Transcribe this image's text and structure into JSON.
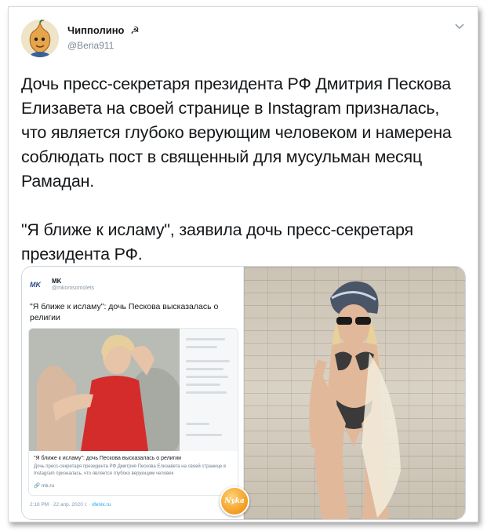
{
  "author": {
    "name": "Чипполино",
    "badge": "☭",
    "handle": "@Beria911",
    "avatar_icon": "cipollino-avatar"
  },
  "tweet": {
    "paragraphs": [
      "Дочь пресс-секретаря президента РФ Дмитрия Пескова Елизавета на своей странице в Instagram призналась, что является глубоко верующим человеком и намерена соблюдать пост в священный для мусульман месяц Рамадан.",
      "\"Я ближе к исламу\", заявила дочь пресс-секретаря президента РФ."
    ]
  },
  "embedded": {
    "logo": "MK",
    "name": "MK",
    "handle": "@mkomsomolets",
    "headline": "\"Я ближе к исламу\": дочь Пескова высказалась о религии",
    "card_title": "\"Я ближе к исламу\": дочь Пескова высказалась о религии",
    "card_desc": "Дочь пресс-секретаря президента РФ Дмитрия Пескова Елизавета на своей странице в Instagram призналась, что является глубоко верующим человек",
    "card_url": "mk.ru",
    "time": "2:18 PM · 22 апр. 2020 г. ·",
    "source": "xfenix.ru"
  },
  "watermark": "Nyka",
  "colors": {
    "link": "#1da1f2",
    "text": "#14171a",
    "muted": "#7a8a99"
  }
}
